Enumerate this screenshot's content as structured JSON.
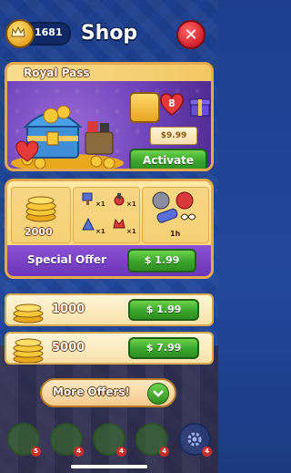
{
  "header": {
    "coins": "1681",
    "title": "Shop"
  },
  "royal_pass": {
    "title": "Royal Pass",
    "hearts": "8",
    "price": "$9.99",
    "button": "Activate"
  },
  "special_offer": {
    "gold_amount": "2000",
    "items": [
      "×1",
      "×1",
      "×1",
      "×1"
    ],
    "timer": "1h",
    "label": "Special Offer",
    "price": "$ 1.99"
  },
  "coin_packs": [
    {
      "amount": "1000",
      "price": "$ 1.99"
    },
    {
      "amount": "5000",
      "price": "$ 7.99"
    }
  ],
  "more_offers": "More Offers!",
  "dock": {
    "badges": [
      "5",
      "4",
      "4",
      "4",
      "4"
    ]
  },
  "colors": {
    "accent_green": "#3aa52c",
    "close_red": "#d11f2a",
    "purple": "#6a35b8",
    "gold": "#f3c862"
  }
}
